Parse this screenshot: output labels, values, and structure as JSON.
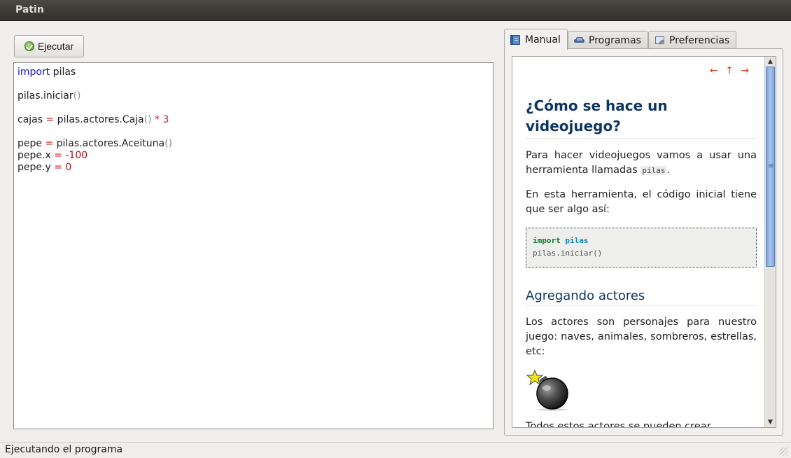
{
  "window": {
    "title": "Patin"
  },
  "toolbar": {
    "run_label": "Ejecutar",
    "run_icon": "ok-check-icon"
  },
  "editor": {
    "lines": [
      [
        {
          "t": "import",
          "c": "kw"
        },
        {
          "t": " pilas",
          "c": ""
        }
      ],
      [],
      [
        {
          "t": "pilas.iniciar",
          "c": ""
        },
        {
          "t": "()",
          "c": "paren"
        }
      ],
      [],
      [
        {
          "t": "cajas ",
          "c": ""
        },
        {
          "t": "=",
          "c": "op"
        },
        {
          "t": " pilas.actores.Caja",
          "c": ""
        },
        {
          "t": "()",
          "c": "paren"
        },
        {
          "t": " * 3",
          "c": "op"
        }
      ],
      [],
      [
        {
          "t": "pepe ",
          "c": ""
        },
        {
          "t": "=",
          "c": "op"
        },
        {
          "t": " pilas.actores.Aceituna",
          "c": ""
        },
        {
          "t": "()",
          "c": "paren"
        }
      ],
      [
        {
          "t": "pepe.x ",
          "c": ""
        },
        {
          "t": "=",
          "c": "op"
        },
        {
          "t": " -100",
          "c": "num"
        }
      ],
      [
        {
          "t": "pepe.y ",
          "c": ""
        },
        {
          "t": "=",
          "c": "op"
        },
        {
          "t": " 0",
          "c": "num"
        }
      ]
    ]
  },
  "tabs": [
    {
      "label": "Manual",
      "icon": "book-icon",
      "active": true
    },
    {
      "label": "Programas",
      "icon": "car-icon",
      "active": false
    },
    {
      "label": "Preferencias",
      "icon": "preferences-icon",
      "active": false
    }
  ],
  "manual": {
    "nav": {
      "prev": "←",
      "up": "↑",
      "next": "→"
    },
    "heading": "¿Cómo se hace un videojuego?",
    "p1_before": "Para hacer videojuegos vamos a usar una herramienta llamadas ",
    "p1_code": "pilas",
    "p1_after": ".",
    "p2": "En esta herramienta, el código inicial tiene que ser algo así:",
    "code_kw": "import",
    "code_mod": " pilas",
    "code_line2": "pilas.iniciar()",
    "subheading": "Agregando actores",
    "p3": "Los actores son personajes para nuestro juego: naves, animales, sombreros, estrellas, etc:",
    "p4": "Todos estos actores se pueden crear",
    "image": "bomb-image"
  },
  "status": {
    "text": "Ejecutando el programa"
  },
  "colors": {
    "keyword": "#1515c9",
    "operator": "#c21f1f",
    "heading": "#0e3561",
    "nav": "#d13a13"
  }
}
